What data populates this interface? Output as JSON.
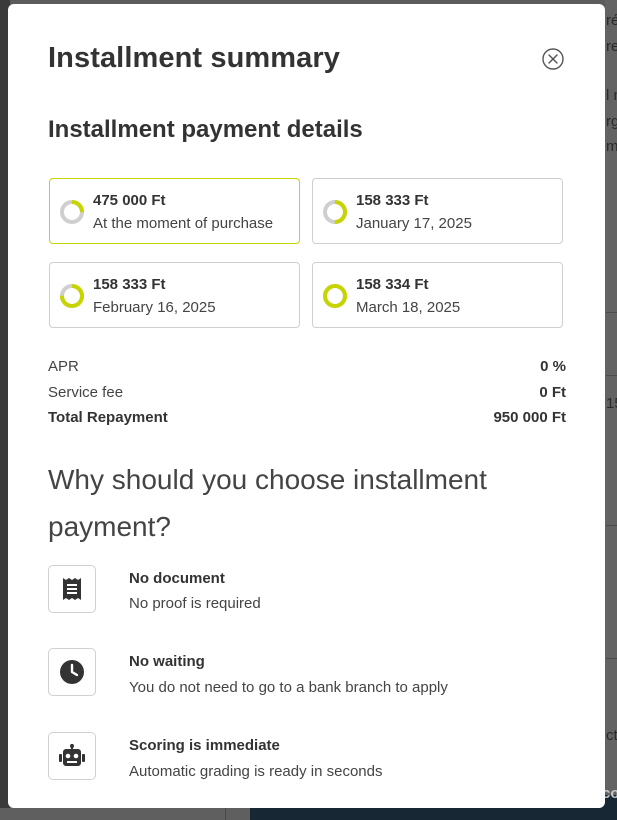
{
  "modal": {
    "title": "Installment summary",
    "subtitle": "Installment payment details",
    "close_icon": "close-circle-icon"
  },
  "installments": [
    {
      "amount": "475 000 Ft",
      "date": "At the moment of purchase",
      "progress": 0.25
    },
    {
      "amount": "158 333 Ft",
      "date": "January 17, 2025",
      "progress": 0.5
    },
    {
      "amount": "158 333 Ft",
      "date": "February 16, 2025",
      "progress": 0.75
    },
    {
      "amount": "158 334 Ft",
      "date": "March 18, 2025",
      "progress": 1.0
    }
  ],
  "summary": {
    "apr_label": "APR",
    "apr_value": "0 %",
    "fee_label": "Service fee",
    "fee_value": "0 Ft",
    "total_label": "Total Repayment",
    "total_value": "950 000 Ft"
  },
  "why": {
    "heading": "Why should you choose installment payment?",
    "features": [
      {
        "icon": "receipt-icon",
        "title": "No document",
        "desc": "No proof is required"
      },
      {
        "icon": "clock-icon",
        "title": "No waiting",
        "desc": "You do not need to go to a bank branch to apply"
      },
      {
        "icon": "robot-icon",
        "title": "Scoring is immediate",
        "desc": "Automatic grading is ready in seconds"
      }
    ]
  },
  "background": {
    "fragments": [
      "ré",
      "rela",
      "l m",
      "rg",
      "m",
      "15",
      "ct",
      "co"
    ]
  },
  "colors": {
    "accent": "#c6d400",
    "ring_track": "#cfcfcf",
    "text_dark": "#333333",
    "overlay": "#5c5c5c"
  }
}
